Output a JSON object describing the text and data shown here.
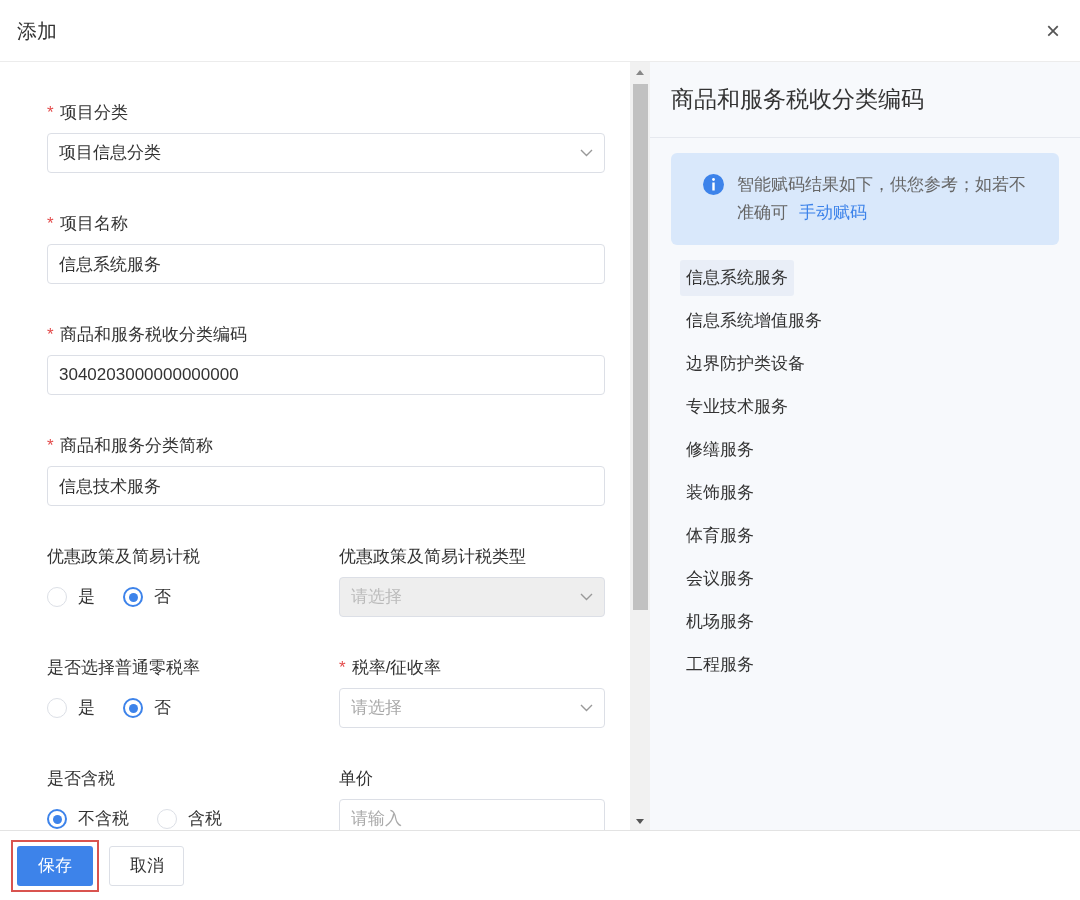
{
  "dialog": {
    "title": "添加",
    "close": "×"
  },
  "form": {
    "fields": [
      {
        "kind": "select",
        "mark": "*",
        "label": "项目分类",
        "value": "项目信息分类"
      },
      {
        "kind": "text",
        "mark": "*",
        "label": "项目名称",
        "value": "信息系统服务"
      },
      {
        "kind": "text",
        "mark": "*",
        "label": "商品和服务税收分类编码",
        "value": "3040203000000000000"
      },
      {
        "kind": "text",
        "mark": "*",
        "label": "商品和服务分类简称",
        "value": "信息技术服务"
      }
    ],
    "pairs": [
      [
        {
          "kind": "radio",
          "label": "优惠政策及简易计税",
          "options": [
            {
              "label": "是",
              "selected": false
            },
            {
              "label": "否",
              "selected": true
            }
          ]
        },
        {
          "kind": "select",
          "label": "优惠政策及简易计税类型",
          "placeholder": "请选择",
          "disabled": true
        }
      ],
      [
        {
          "kind": "radio",
          "label": "是否选择普通零税率",
          "options": [
            {
              "label": "是",
              "selected": false
            },
            {
              "label": "否",
              "selected": true
            }
          ]
        },
        {
          "kind": "select",
          "mark": "*",
          "label": "税率/征收率",
          "placeholder": "请选择",
          "disabled": false
        }
      ],
      [
        {
          "kind": "radio",
          "label": "是否含税",
          "options": [
            {
              "label": "不含税",
              "selected": true
            },
            {
              "label": "含税",
              "selected": false
            }
          ]
        },
        {
          "kind": "text",
          "label": "单价",
          "placeholder": "请输入"
        }
      ]
    ]
  },
  "code_panel": {
    "title": "商品和服务税收分类编码",
    "notice": {
      "text": "智能赋码结果如下，供您参考；如若不准确可",
      "link": "手动赋码"
    },
    "suggestions": [
      {
        "label": "信息系统服务",
        "selected": true
      },
      {
        "label": "信息系统增值服务",
        "selected": false
      },
      {
        "label": "边界防护类设备",
        "selected": false
      },
      {
        "label": "专业技术服务",
        "selected": false
      },
      {
        "label": "修缮服务",
        "selected": false
      },
      {
        "label": "装饰服务",
        "selected": false
      },
      {
        "label": "体育服务",
        "selected": false
      },
      {
        "label": "会议服务",
        "selected": false
      },
      {
        "label": "机场服务",
        "selected": false
      },
      {
        "label": "工程服务",
        "selected": false
      }
    ]
  },
  "buttons": [
    {
      "label": "保存",
      "kind": "primary",
      "highlighted": true
    },
    {
      "label": "取消",
      "kind": "default",
      "highlighted": false
    }
  ]
}
